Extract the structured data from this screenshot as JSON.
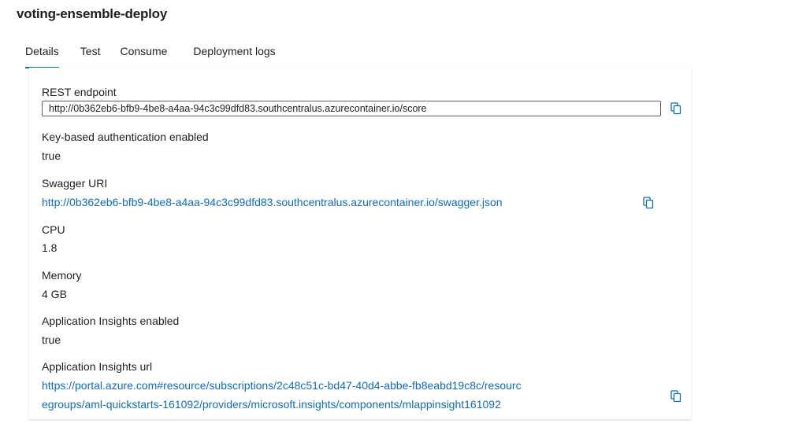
{
  "page": {
    "title": "voting-ensemble-deploy"
  },
  "tabs": [
    {
      "label": "Details",
      "active": true
    },
    {
      "label": "Test",
      "active": false
    },
    {
      "label": "Consume",
      "active": false
    },
    {
      "label": "Deployment logs",
      "active": false
    }
  ],
  "details": {
    "rest_endpoint": {
      "label": "REST endpoint",
      "value": "http://0b362eb6-bfb9-4be8-a4aa-94c3c99dfd83.southcentralus.azurecontainer.io/score"
    },
    "key_auth": {
      "label": "Key-based authentication enabled",
      "value": "true"
    },
    "swagger": {
      "label": "Swagger URI",
      "value": "http://0b362eb6-bfb9-4be8-a4aa-94c3c99dfd83.southcentralus.azurecontainer.io/swagger.json"
    },
    "cpu": {
      "label": "CPU",
      "value": "1.8"
    },
    "memory": {
      "label": "Memory",
      "value": "4 GB"
    },
    "app_insights": {
      "label": "Application Insights enabled",
      "value": "true"
    },
    "app_insights_url": {
      "label": "Application Insights url",
      "line1": "https://portal.azure.com#resource/subscriptions/2c48c51c-bd47-40d4-abbe-fb8eabd19c8c/resourc",
      "line2": "egroups/aml-quickstarts-161092/providers/microsoft.insights/components/mlappinsight161092"
    }
  },
  "colors": {
    "accent": "#0078d4",
    "link": "#0f6cbd",
    "text": "#201f1e"
  },
  "icons": {
    "copy": "copy-icon"
  }
}
